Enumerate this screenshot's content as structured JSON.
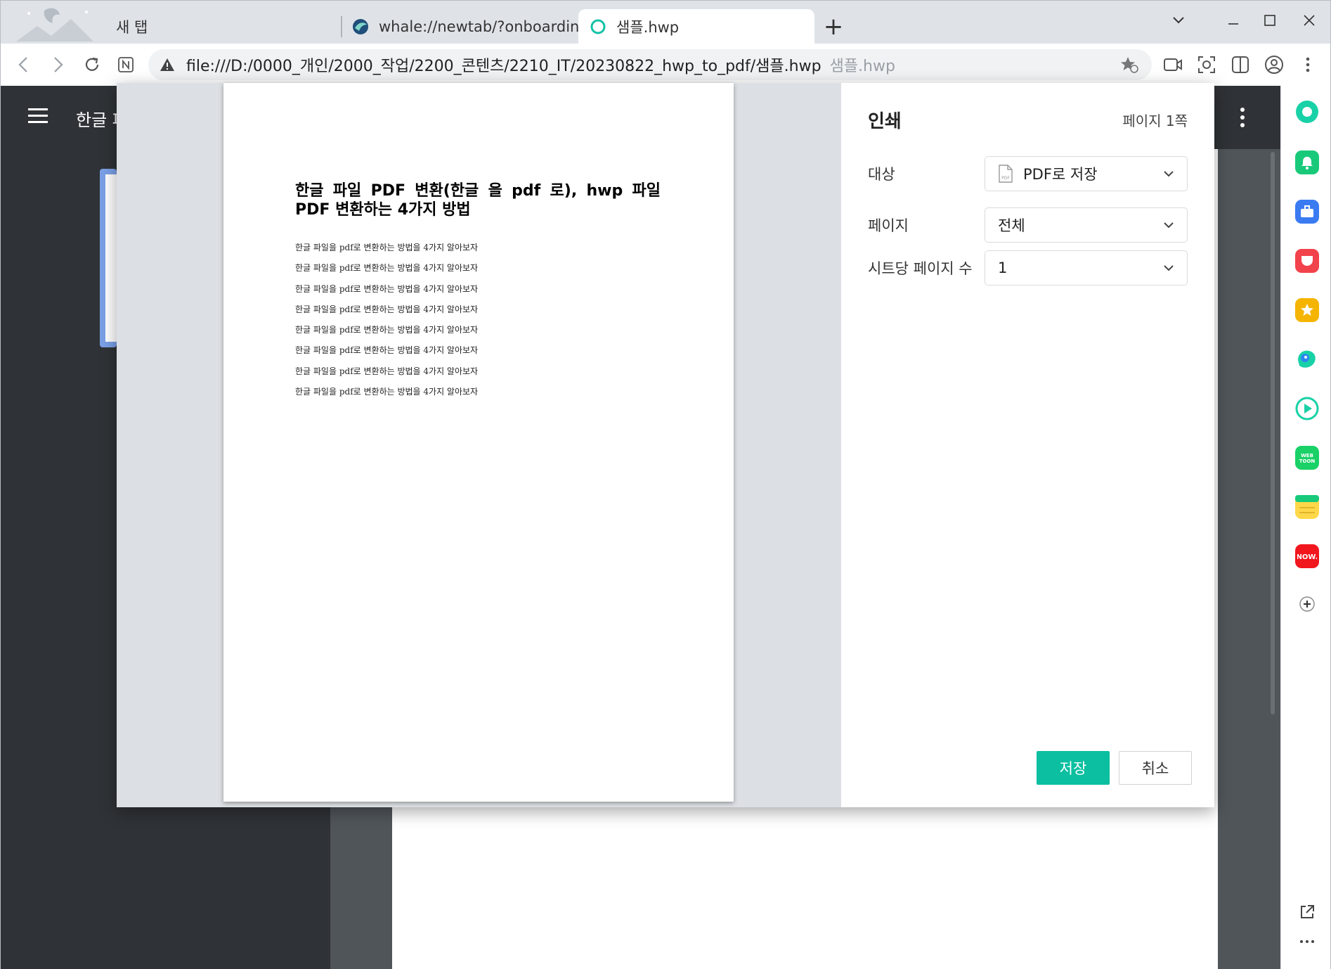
{
  "tabs": [
    {
      "label": "새 탭",
      "active": false
    },
    {
      "label": "whale://newtab/?onboarding",
      "active": false
    },
    {
      "label": "샘플.hwp",
      "active": true
    }
  ],
  "toolbar": {
    "url": "file:///D:/0000_개인/2000_작업/2200_콘텐츠/2210_IT/20230822_hwp_to_pdf/샘플.hwp",
    "page_title": "샘플.hwp"
  },
  "app": {
    "title": "한글 파"
  },
  "print": {
    "title": "인쇄",
    "page_count": "페이지 1쪽",
    "rows": [
      {
        "label": "대상",
        "value": "PDF로 저장",
        "icon": "pdf-file-icon"
      },
      {
        "label": "페이지",
        "value": "전체"
      },
      {
        "label": "시트당 페이지 수",
        "value": "1"
      }
    ],
    "save_label": "저장",
    "cancel_label": "취소"
  },
  "preview": {
    "title_line1": "한글 파일 PDF 변환(한글 을 pdf 로), hwp 파일",
    "title_line2": "PDF 변환하는 4가지 방법",
    "lines": [
      "한글 파일을 pdf로 변환하는 방법을 4가지 알아보자",
      "한글 파일을 pdf로 변환하는 방법을 4가지 알아보자",
      "한글 파일을 pdf로 변환하는 방법을 4가지 알아보자",
      "한글 파일을 pdf로 변환하는 방법을 4가지 알아보자",
      "한글 파일을 pdf로 변환하는 방법을 4가지 알아보자",
      "한글 파일을 pdf로 변환하는 방법을 4가지 알아보자",
      "한글 파일을 pdf로 변환하는 방법을 4가지 알아보자",
      "한글 파일을 pdf로 변환하는 방법을 4가지 알아보자"
    ]
  },
  "colors": {
    "accent": "#0bbfa0",
    "app_dark": "#2f3236"
  }
}
